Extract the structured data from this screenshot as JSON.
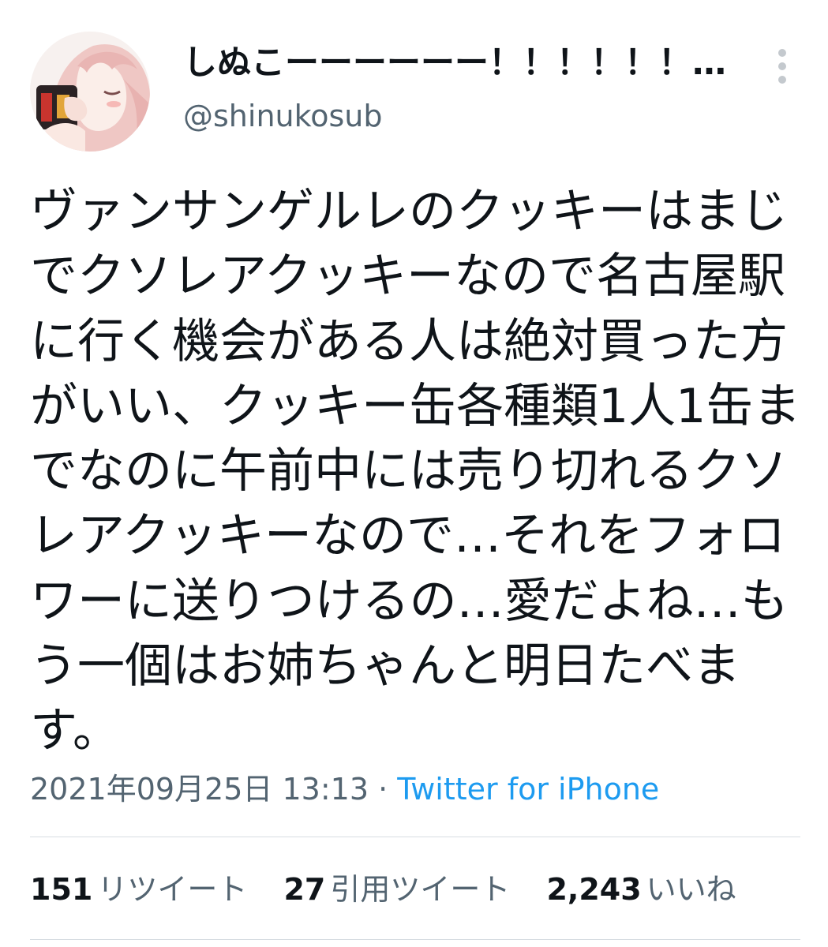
{
  "tweet": {
    "display_name": "しぬこーーーーーー！！！！！！！…",
    "handle": "@shinukosub",
    "text": "ヴァンサンゲルレのクッキーはまじ\nでクソレアクッキーなので名古屋駅\nに行く機会がある人は絶対買った方\nがいい、クッキー缶各種類1人1缶ま\nでなのに午前中には売り切れるクソ\nレアクッキーなので…それをフォロ\nワーに送りつけるの…愛だよね…も\nう一個はお姉ちゃんと明日たべま\nす。",
    "date": "2021年09月25日 13:13",
    "separator": " · ",
    "source": "Twitter for iPhone"
  },
  "stats": {
    "retweets": {
      "count": "151",
      "label": "リツイート"
    },
    "quotes": {
      "count": "27",
      "label": "引用ツイート"
    },
    "likes": {
      "count": "2,243",
      "label": "いいね"
    }
  },
  "icons": {
    "more": "more-vertical-icon",
    "avatar": "anime-girl-drinking-avatar"
  },
  "colors": {
    "text": "#0f1419",
    "secondary": "#536471",
    "link": "#1d9bf0",
    "divider": "#d7dde2"
  }
}
